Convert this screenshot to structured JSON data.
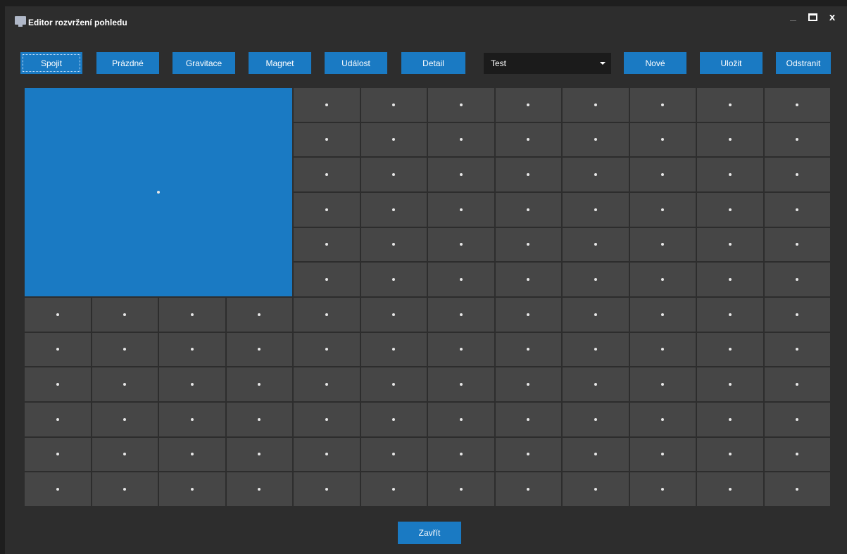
{
  "window": {
    "title": "Editor rozvržení pohledu",
    "icon": "monitor-icon",
    "controls": [
      "minimize-icon",
      "maximize-icon",
      "close-icon"
    ],
    "close_glyph": "x"
  },
  "toolbar": {
    "buttons": [
      {
        "id": "spojit",
        "label": "Spojit"
      },
      {
        "id": "prazdne",
        "label": "Prázdné"
      },
      {
        "id": "gravitace",
        "label": "Gravitace"
      },
      {
        "id": "magnet",
        "label": "Magnet"
      },
      {
        "id": "udalost",
        "label": "Událost"
      },
      {
        "id": "detail",
        "label": "Detail"
      }
    ],
    "layout_select": {
      "value": "Test"
    },
    "actions": [
      {
        "id": "nove",
        "label": "Nové"
      },
      {
        "id": "ulozit",
        "label": "Uložit"
      },
      {
        "id": "odstranit",
        "label": "Odstranit"
      }
    ]
  },
  "grid": {
    "columns": 12,
    "rows": 12,
    "merged_region": {
      "col": 0,
      "row": 0,
      "col_span": 4,
      "row_span": 6
    }
  },
  "footer": {
    "close_label": "Zavřít"
  },
  "colors": {
    "accent": "#1a7ac3",
    "background": "#2d2d2d",
    "cell": "#464646",
    "frame": "#1e1e1e",
    "select_bg": "#1b1b1b"
  }
}
